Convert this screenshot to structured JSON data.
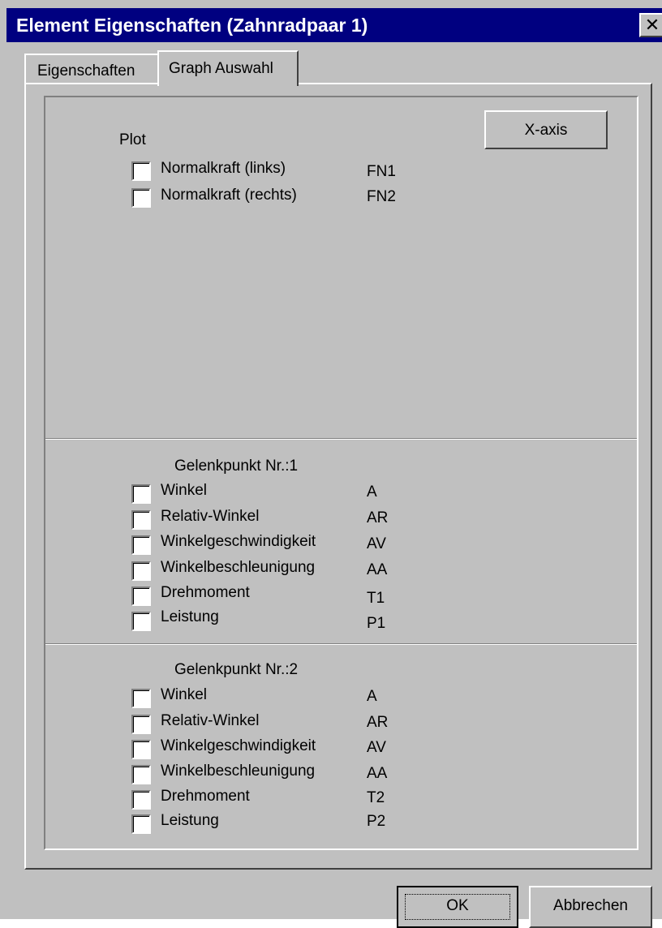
{
  "window": {
    "title": "Element Eigenschaften (Zahnradpaar 1)",
    "close_glyph": "✕"
  },
  "tabs": [
    {
      "label": "Eigenschaften",
      "active": false
    },
    {
      "label": "Graph Auswahl",
      "active": true
    }
  ],
  "plot": {
    "heading": "Plot",
    "x_axis_button": "X-axis",
    "items": [
      {
        "label": "Normalkraft (links)",
        "code": "FN1",
        "checked": false
      },
      {
        "label": "Normalkraft (rechts)",
        "code": "FN2",
        "checked": false
      }
    ]
  },
  "joint1": {
    "heading": "Gelenkpunkt Nr.:1",
    "items": [
      {
        "label": "Winkel",
        "code": "A",
        "checked": false
      },
      {
        "label": "Relativ-Winkel",
        "code": "AR",
        "checked": false
      },
      {
        "label": "Winkelgeschwindigkeit",
        "code": "AV",
        "checked": false
      },
      {
        "label": "Winkelbeschleunigung",
        "code": "AA",
        "checked": false
      },
      {
        "label": "Drehmoment",
        "code": "T1",
        "checked": false
      },
      {
        "label": "Leistung",
        "code": "P1",
        "checked": false
      }
    ]
  },
  "joint2": {
    "heading": "Gelenkpunkt Nr.:2",
    "items": [
      {
        "label": "Winkel",
        "code": "A",
        "checked": false
      },
      {
        "label": "Relativ-Winkel",
        "code": "AR",
        "checked": false
      },
      {
        "label": "Winkelgeschwindigkeit",
        "code": "AV",
        "checked": false
      },
      {
        "label": "Winkelbeschleunigung",
        "code": "AA",
        "checked": false
      },
      {
        "label": "Drehmoment",
        "code": "T2",
        "checked": false
      },
      {
        "label": "Leistung",
        "code": "P2",
        "checked": false
      }
    ]
  },
  "buttons": {
    "ok": "OK",
    "cancel": "Abbrechen"
  },
  "colors": {
    "titlebar": "#000080",
    "face": "#c0c0c0",
    "title_text": "#ffffff"
  }
}
